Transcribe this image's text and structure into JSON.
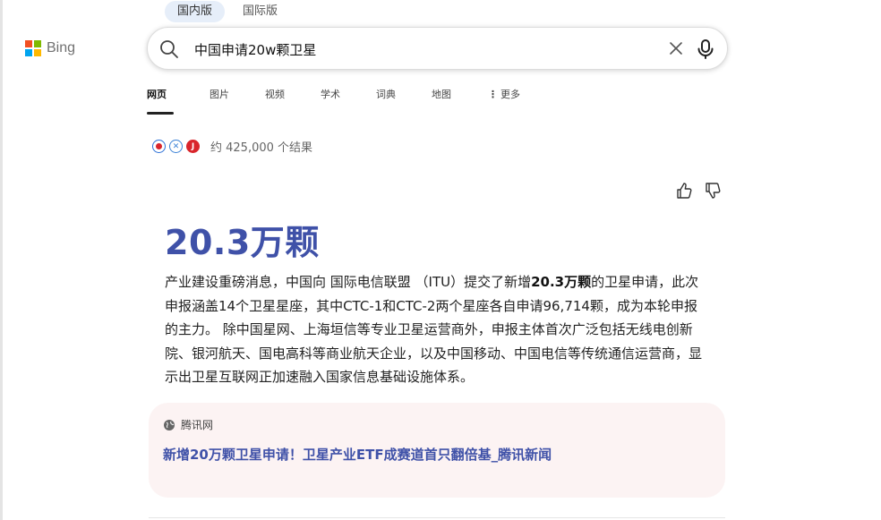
{
  "region_tabs": [
    {
      "label": "国内版",
      "active": true
    },
    {
      "label": "国际版",
      "active": false
    }
  ],
  "logo": {
    "text": "Bing",
    "colors": [
      "#f25022",
      "#7fba00",
      "#00a4ef",
      "#ffb900"
    ]
  },
  "search": {
    "query": "中国申请20w颗卫星",
    "icons": [
      "search-icon",
      "clear-icon",
      "microphone-icon"
    ]
  },
  "nav_tabs": [
    {
      "label": "网页",
      "active": true
    },
    {
      "label": "图片"
    },
    {
      "label": "视频"
    },
    {
      "label": "学术"
    },
    {
      "label": "词典"
    },
    {
      "label": "地图"
    },
    {
      "label": "更多"
    }
  ],
  "results": {
    "count_text": "约 425,000 个结果"
  },
  "answer": {
    "title": "20.3万颗",
    "body_part1": "产业建设重磅消息，中国向 国际电信联盟 （ITU）提交了新增",
    "body_bold": "20.3万颗",
    "body_part2": "的卫星申请，此次申报涵盖14个卫星星座，其中CTC-1和CTC-2两个星座各自申请96,714颗，成为本轮申报的主力。 除中国星网、上海垣信等专业卫星运营商外，申报主体首次广泛包括无线电创新院、银河航天、国电高科等商业航天企业，以及中国移动、中国电信等传统通信运营商，显示出卫星互联网正加速融入国家信息基础设施体系。"
  },
  "source": {
    "site": "腾讯网",
    "link_text": "新增20万颗卫星申请！卫星产业ETF成赛道首只翻倍基_腾讯新闻"
  },
  "colors": {
    "accent": "#3f51a8",
    "card_bg": "#fcf3f3"
  }
}
